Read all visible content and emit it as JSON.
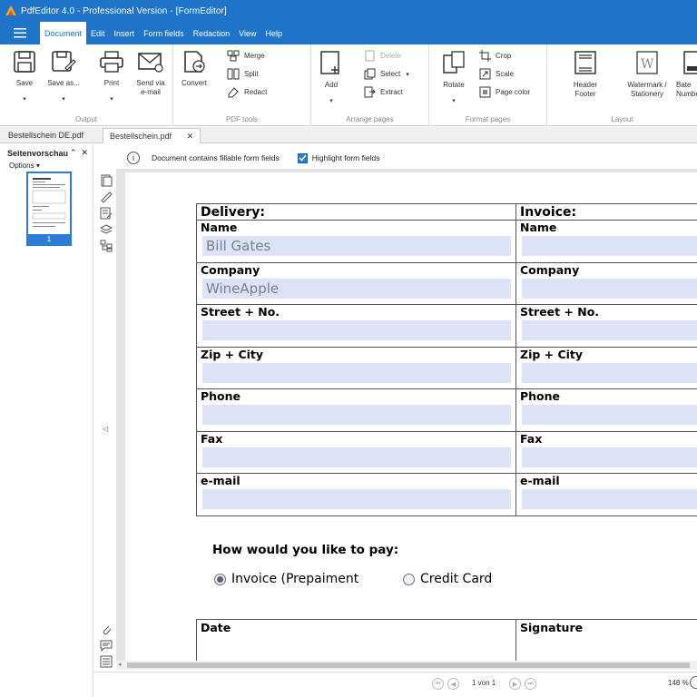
{
  "window": {
    "title": "PdfEditor 4.0 - Professional Version - [FormEditor]"
  },
  "menu": {
    "items": [
      "Document",
      "Edit",
      "Insert",
      "Form fields",
      "Redaction",
      "View",
      "Help"
    ],
    "active": "Document"
  },
  "ribbon": {
    "groups": {
      "output": "Output",
      "pdf_tools": "PDF tools",
      "arrange_pages": "Arrange pages",
      "format_pages": "Format pages",
      "layout": "Layout"
    },
    "save": "Save",
    "save_as": "Save as...",
    "print": "Print",
    "send_line1": "Send via",
    "send_line2": "e-mail",
    "convert": "Convert",
    "merge": "Merge",
    "split": "Split",
    "redact": "Redact",
    "add": "Add",
    "delete": "Delete",
    "select": "Select",
    "extract": "Extract",
    "rotate": "Rotate",
    "crop": "Crop",
    "scale": "Scale",
    "page_color": "Page color",
    "header_line1": "Header",
    "header_line2": "Footer",
    "watermark_line1": "Watermark /",
    "watermark_line2": "Stationery",
    "bates_line1": "Bate",
    "bates_line2": "Numbe"
  },
  "tabs": [
    {
      "label": "Bestellschein DE.pdf",
      "active": false
    },
    {
      "label": "Bestellschein.pdf",
      "active": true
    }
  ],
  "left_panel": {
    "title": "Seitenvorschau",
    "options": "Options",
    "thumb_page": "1"
  },
  "infobar": {
    "message": "Document contains fillable form fields",
    "highlight_label": "Highlight form fields",
    "highlight_checked": true
  },
  "form": {
    "delivery_header": "Delivery:",
    "invoice_header": "Invoice:",
    "rows": [
      {
        "label": "Name",
        "delivery_value": "Bill  Gates",
        "invoice_value": ""
      },
      {
        "label": "Company",
        "delivery_value": "WineApple",
        "invoice_value": ""
      },
      {
        "label": "Street + No.",
        "delivery_value": "",
        "invoice_value": ""
      },
      {
        "label": "Zip + City",
        "delivery_value": "",
        "invoice_value": ""
      },
      {
        "label": "Phone",
        "delivery_value": "",
        "invoice_value": ""
      },
      {
        "label": "Fax",
        "delivery_value": "",
        "invoice_value": ""
      },
      {
        "label": "e-mail",
        "delivery_value": "",
        "invoice_value": ""
      }
    ],
    "pay_question": "How would you like to pay:",
    "payment_options": [
      {
        "label": "Invoice (Prepaiment",
        "selected": true
      },
      {
        "label": "Credit Card",
        "selected": false
      }
    ],
    "date_label": "Date",
    "signature_label": "Signature"
  },
  "status": {
    "page_indicator": "1 von 1",
    "zoom": "148 %"
  },
  "colors": {
    "accent": "#1e74c8",
    "field_fill": "#dde3f7",
    "selection": "#2b7cd3"
  }
}
